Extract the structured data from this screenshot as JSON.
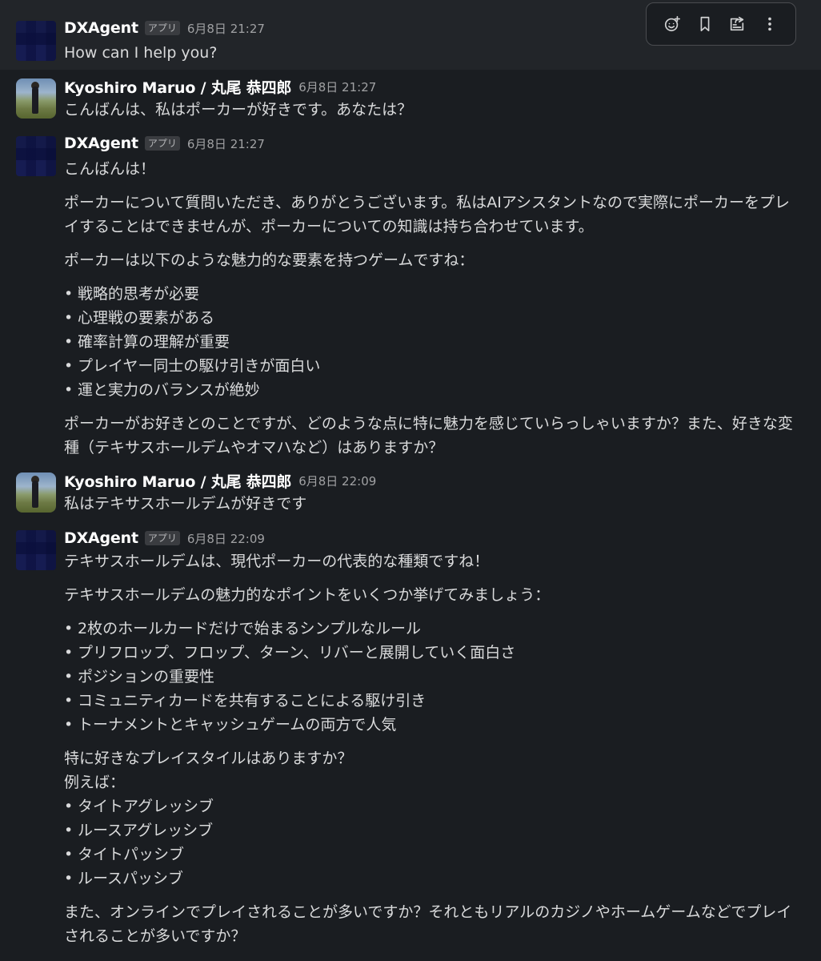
{
  "toolbar": {
    "actions": [
      {
        "icon": "add-reaction-icon"
      },
      {
        "icon": "bookmark-icon"
      },
      {
        "icon": "forward-message-icon"
      },
      {
        "icon": "more-actions-icon"
      }
    ]
  },
  "messages": [
    {
      "sender": "DXAgent",
      "badge": "アプリ",
      "time": "6月8日 21:27",
      "lines": [
        "How can I help you?"
      ]
    },
    {
      "sender": "Kyoshiro Maruo / 丸尾 恭四郎",
      "time": "6月8日 21:27",
      "lines": [
        "こんばんは、私はポーカーが好きです。あなたは？"
      ]
    },
    {
      "sender": "DXAgent",
      "badge": "アプリ",
      "time": "6月8日 21:27",
      "lines": [
        "こんばんは！",
        "ポーカーについて質問いただき、ありがとうございます。私はAIアシスタントなので実際にポーカーをプレイすることはできませんが、ポーカーについての知識は持ち合わせています。",
        "ポーカーは以下のような魅力的な要素を持つゲームですね：",
        "戦略的思考が必要",
        "心理戦の要素がある",
        "確率計算の理解が重要",
        "プレイヤー同士の駆け引きが面白い",
        "運と実力のバランスが絶妙",
        "ポーカーがお好きとのことですが、どのような点に特に魅力を感じていらっしゃいますか？また、好きな変種（テキサスホールデムやオマハなど）はありますか？"
      ]
    },
    {
      "sender": "Kyoshiro Maruo / 丸尾 恭四郎",
      "time": "6月8日 22:09",
      "lines": [
        "私はテキサスホールデムが好きです"
      ]
    },
    {
      "sender": "DXAgent",
      "badge": "アプリ",
      "time": "6月8日 22:09",
      "lines": [
        "テキサスホールデムは、現代ポーカーの代表的な種類ですね！",
        "テキサスホールデムの魅力的なポイントをいくつか挙げてみましょう：",
        "2枚のホールカードだけで始まるシンプルなルール",
        "プリフロップ、フロップ、ターン、リバーと展開していく面白さ",
        "ポジションの重要性",
        "コミュニティカードを共有することによる駆け引き",
        "トーナメントとキャッシュゲームの両方で人気",
        "特に好きなプレイスタイルはありますか？",
        "例えば：",
        "タイトアグレッシブ",
        "ルースアグレッシブ",
        "タイトパッシブ",
        "ルースパッシブ",
        "また、オンラインでプレイされることが多いですか？それともリアルのカジノやホームゲームなどでプレイされることが多いですか？"
      ]
    }
  ],
  "colors": {
    "background": "#1a1d21",
    "hover_background": "#222529",
    "text": "#d9dadb",
    "sender": "#ffffff",
    "timestamp": "#a0a1a3"
  }
}
